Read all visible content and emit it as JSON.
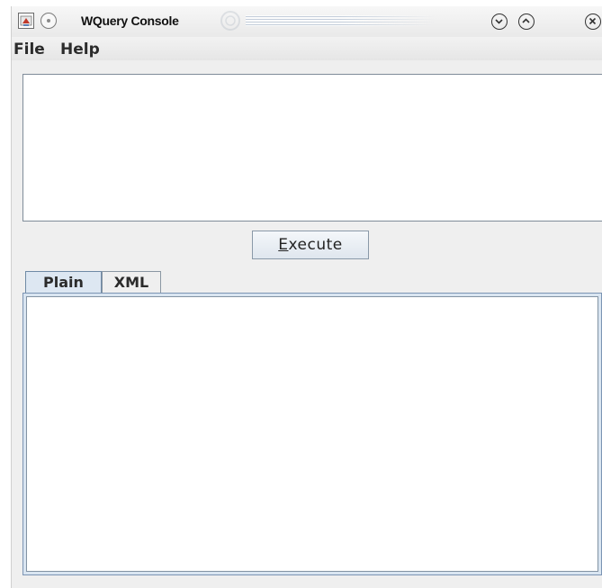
{
  "window": {
    "title": "WQuery Console"
  },
  "menubar": {
    "items": [
      {
        "label": "File"
      },
      {
        "label": "Help"
      }
    ]
  },
  "query_input": {
    "value": ""
  },
  "execute_button": {
    "mnemonic": "E",
    "rest": "xecute"
  },
  "tabs": [
    {
      "label": "Plain",
      "selected": true
    },
    {
      "label": "XML",
      "selected": false
    }
  ],
  "output": {
    "value": ""
  },
  "icons": {
    "app": "java-icon",
    "sticky": "sticky-icon",
    "minimize": "chevron-down-icon",
    "maximize": "chevron-up-icon",
    "close": "close-icon"
  },
  "colors": {
    "window_bg": "#efefef",
    "active_tab_bg": "#dde7f2",
    "border_blue": "#7c95b4"
  }
}
